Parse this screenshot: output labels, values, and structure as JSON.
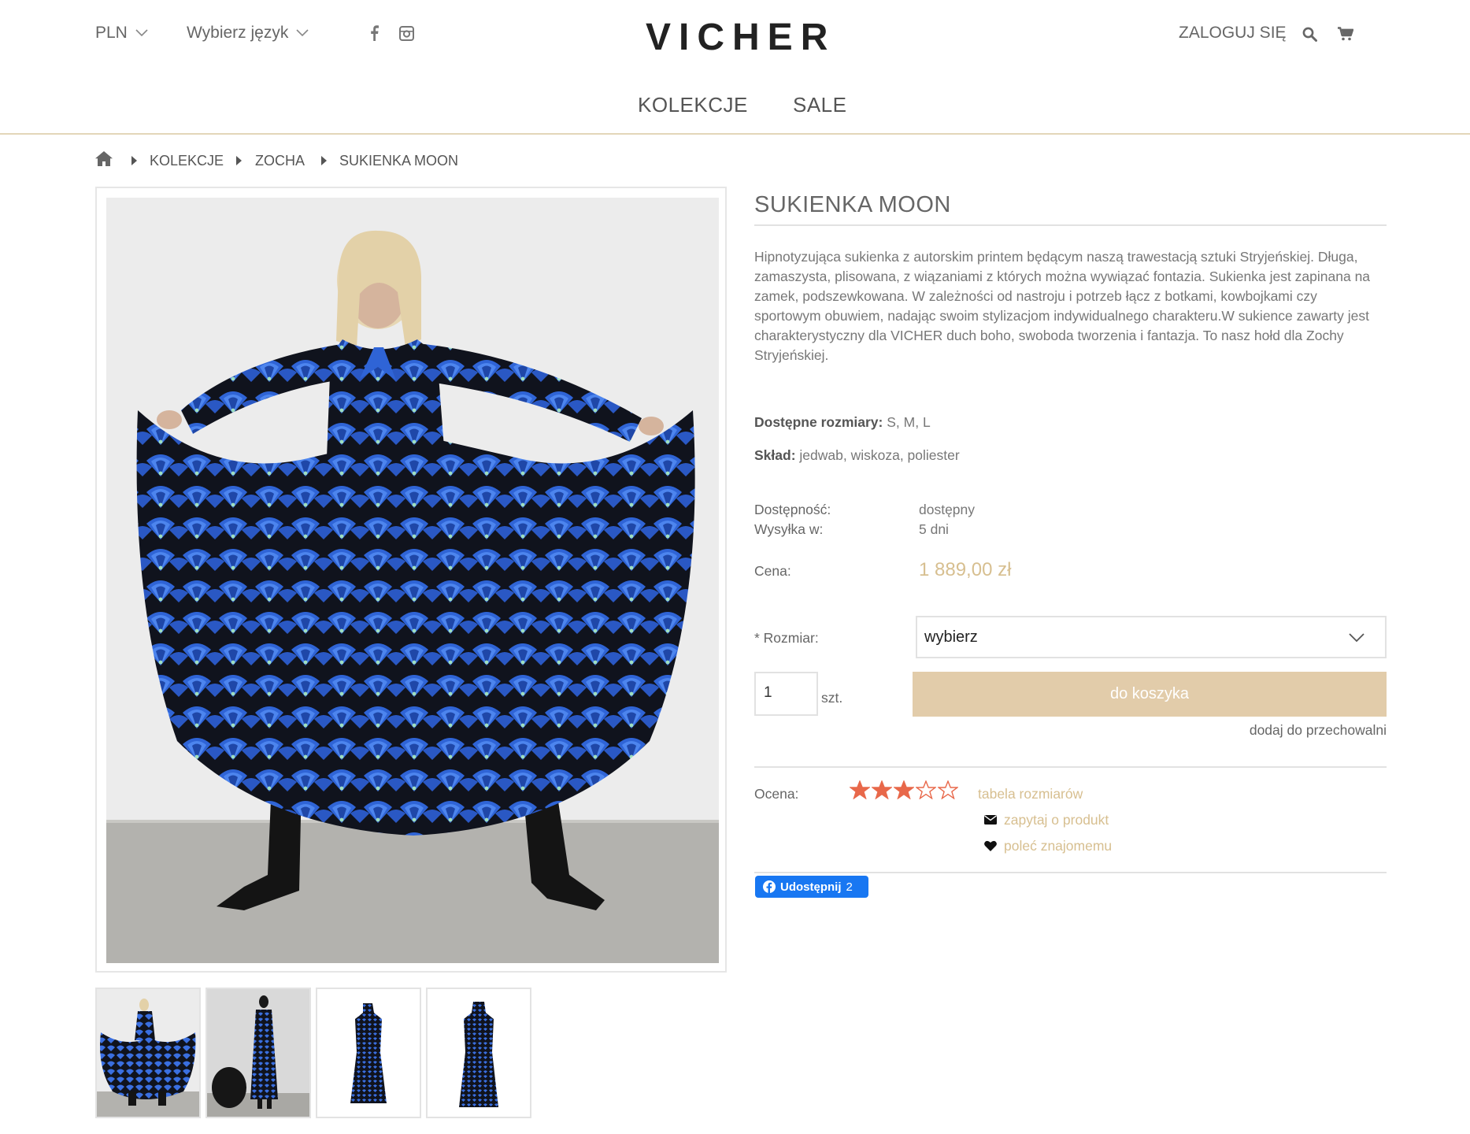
{
  "header": {
    "currency": "PLN",
    "language": "Wybierz język",
    "logo": "VICHER",
    "login": "ZALOGUJ SIĘ",
    "nav": [
      "KOLEKCJE",
      "SALE"
    ]
  },
  "breadcrumb": [
    "KOLEKCJE",
    "ZOCHA",
    "SUKIENKA MOON"
  ],
  "product": {
    "title": "SUKIENKA MOON",
    "description": "Hipnotyzująca sukienka z autorskim printem będącym naszą trawestacją sztuki Stryjeńskiej. Długa, zamaszysta, plisowana, z wiązaniami z których można wywiązać fontazia. Sukienka jest zapinana na zamek, podszewkowana. W zależności od nastroju i potrzeb łącz z botkami, kowbojkami czy sportowym obuwiem, nadając swoim stylizacjom indywidualnego charakteru.W sukience zawarty jest charakterystyczny dla VICHER duch boho, swoboda tworzenia i fantazja. To nasz hołd dla Zochy Stryjeńskiej.",
    "sizes_label": "Dostępne rozmiary:",
    "sizes_value": "S, M, L",
    "composition_label": "Skład:",
    "composition_value": "jedwab, wiskoza, poliester",
    "availability_label": "Dostępność:",
    "availability_value": "dostępny",
    "shipping_label": "Wysyłka w:",
    "shipping_value": "5 dni",
    "price_label": "Cena:",
    "price_value": "1 889,00 zł",
    "size_label": "* Rozmiar:",
    "size_select": "wybierz",
    "quantity": "1",
    "quantity_unit": "szt.",
    "add_to_cart": "do koszyka",
    "add_to_storage": "dodaj do przechowalni",
    "rating_label": "Ocena:",
    "rating": 3,
    "rating_max": 5,
    "size_table": "tabela rozmiarów",
    "ask": "zapytaj o produkt",
    "recommend": "poleć znajomemu",
    "fb_share": "Udostępnij",
    "fb_count": "2"
  },
  "colors": {
    "accent_gold": "#d7bf90",
    "button_beige": "#e2ccaa",
    "star": "#e8684a",
    "facebook": "#1877f2",
    "dress_blue": "#2f64d6"
  }
}
